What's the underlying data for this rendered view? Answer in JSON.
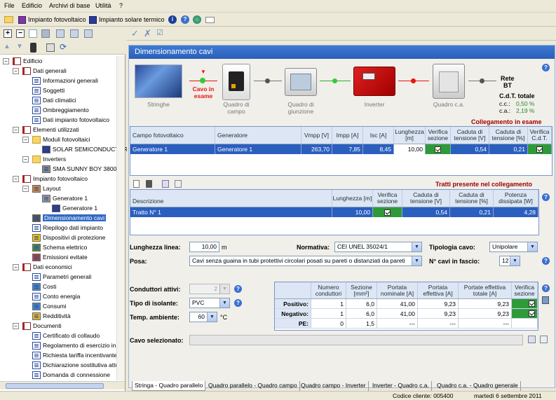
{
  "menu": [
    "File",
    "Edificio",
    "Archivi di base",
    "Utilità",
    "?"
  ],
  "toolbar": {
    "items": [
      "Impianto fotovoltaico",
      "Impianto solare termico"
    ]
  },
  "tree": [
    {
      "label": "Edificio",
      "level": 0,
      "icon": "book-icon"
    },
    {
      "label": "Dati generali",
      "level": 1,
      "icon": "book-icon"
    },
    {
      "label": "Informazioni generali",
      "level": 2,
      "icon": "document-icon"
    },
    {
      "label": "Soggetti",
      "level": 2,
      "icon": "document-icon"
    },
    {
      "label": "Dati climatici",
      "level": 2,
      "icon": "document-icon"
    },
    {
      "label": "Ombreggiamento",
      "level": 2,
      "icon": "document-icon"
    },
    {
      "label": "Dati impianto fotovoltaico",
      "level": 2,
      "icon": "document-icon"
    },
    {
      "label": "Elementi utilizzati",
      "level": 1,
      "icon": "book-icon"
    },
    {
      "label": "Moduli fotovoltaici",
      "level": 2,
      "icon": "folder-icon"
    },
    {
      "label": "SOLAR SEMICONDUCTOR",
      "level": 3,
      "icon": "module-icon"
    },
    {
      "label": "Inverters",
      "level": 2,
      "icon": "folder-icon"
    },
    {
      "label": "SMA SUNNY BOY 3800",
      "level": 3,
      "icon": "inverter-icon"
    },
    {
      "label": "Impianto fotovoltaico",
      "level": 1,
      "icon": "book-icon"
    },
    {
      "label": "Layout",
      "level": 2,
      "icon": "layout-icon"
    },
    {
      "label": "Generatore 1",
      "level": 3,
      "icon": "generator-icon"
    },
    {
      "label": "Generatore 1",
      "level": 4,
      "icon": "module-icon"
    },
    {
      "label": "Dimensionamento cavi",
      "level": 2,
      "icon": "cable-icon",
      "selected": true
    },
    {
      "label": "Riepilogo dati impianto",
      "level": 2,
      "icon": "document-icon"
    },
    {
      "label": "Dispositivi di protezione",
      "level": 2,
      "icon": "warning-icon"
    },
    {
      "label": "Schema elettrico",
      "level": 2,
      "icon": "schema-icon"
    },
    {
      "label": "Emissioni evitate",
      "level": 2,
      "icon": "chart-icon"
    },
    {
      "label": "Dati economici",
      "level": 1,
      "icon": "book-icon"
    },
    {
      "label": "Parametri generali",
      "level": 2,
      "icon": "document-icon"
    },
    {
      "label": "Costi",
      "level": 2,
      "icon": "table-icon"
    },
    {
      "label": "Conto energia",
      "level": 2,
      "icon": "document-icon"
    },
    {
      "label": "Consumi",
      "level": 2,
      "icon": "table-icon"
    },
    {
      "label": "Redditività",
      "level": 2,
      "icon": "coin-icon"
    },
    {
      "label": "Documenti",
      "level": 1,
      "icon": "book-icon"
    },
    {
      "label": "Certificato di collaudo",
      "level": 2,
      "icon": "document-icon"
    },
    {
      "label": "Regolamento di esercizio in pa",
      "level": 2,
      "icon": "document-icon"
    },
    {
      "label": "Richiesta tariffa incentivante (",
      "level": 2,
      "icon": "document-icon"
    },
    {
      "label": "Dichiarazione sostitutiva atto c",
      "level": 2,
      "icon": "document-icon"
    },
    {
      "label": "Domanda di connessione",
      "level": 2,
      "icon": "document-icon"
    }
  ],
  "content": {
    "title": "Dimensionamento cavi",
    "schematic": {
      "stringhe": "Stringhe",
      "cavo_in_esame": "Cavo in esame",
      "quadro_campo": "Quadro di campo",
      "quadro_giunzione": "Quadro di giunzione",
      "inverter": "Inverter",
      "quadro_ca": "Quadro c.a.",
      "rete": "Rete",
      "bt": "BT",
      "cdt_totale": "C.d.T. totale",
      "cc_label": "c.c.:",
      "cc_value": "0,50 %",
      "ca_label": "c.a.:",
      "ca_value": "2,19 %"
    },
    "collegamento_label": "Collegamento in esame",
    "table1": {
      "headers": [
        "Campo fotovoltaico",
        "Generatore",
        "Vmpp [V]",
        "Impp [A]",
        "Isc [A]",
        "Lunghezza [m]",
        "Verifica sezione",
        "Caduta di tensione [V]",
        "Caduta di tensione [%]",
        "Verifica C.d.T."
      ],
      "rows": [
        [
          "Generatore 1",
          "Generatore 1",
          "263,70",
          "7,85",
          "8,45",
          "10,00",
          "",
          "0,54",
          "0,21",
          ""
        ]
      ]
    },
    "tratti_label": "Tratti presente nel collegamento",
    "table2": {
      "headers": [
        "Descrizione",
        "Lunghezza [m]",
        "Verifica sezione",
        "Caduta di tensione [V]",
        "Caduta di tensione [%]",
        "Potenza dissipata [W]"
      ],
      "rows": [
        [
          "Tratto N° 1",
          "10,00",
          "",
          "0,54",
          "0,21",
          "4,28"
        ]
      ]
    },
    "form": {
      "lunghezza_label": "Lunghezza linea:",
      "lunghezza_value": "10,00",
      "lunghezza_unit": "m",
      "normativa_label": "Normativa:",
      "normativa_value": "CEI UNEL 35024/1",
      "tipologia_label": "Tipologia cavo:",
      "tipologia_value": "Unipolare",
      "posa_label": "Posa:",
      "posa_value": "Cavi senza guaina in tubi protettivi circolari posati su pareti o distanziati da pareti",
      "ncavi_label": "N° cavi in fascio:",
      "ncavi_value": "12",
      "conduttori_label": "Conduttori attivi:",
      "conduttori_value": "2",
      "isolante_label": "Tipo di isolante:",
      "isolante_value": "PVC",
      "temp_label": "Temp. ambiente:",
      "temp_value": "60",
      "temp_unit": "°C",
      "cavo_sel_label": "Cavo selezionato:"
    },
    "table3": {
      "headers": [
        "",
        "Numero conduttori",
        "Sezione [mm²]",
        "Portata nominale [A]",
        "Portata effettiva [A]",
        "Portate effettiva totale [A]",
        "Verifica sezione"
      ],
      "rows": [
        [
          "Positivo:",
          "1",
          "6,0",
          "41,00",
          "9,23",
          "9,23",
          ""
        ],
        [
          "Negativo:",
          "1",
          "6,0",
          "41,00",
          "9,23",
          "9,23",
          ""
        ],
        [
          "PE:",
          "0",
          "1,5",
          "---",
          "---",
          "---",
          ""
        ]
      ]
    },
    "tabs": [
      "Stringa - Quadro parallelo",
      "Quadro parallelo - Quadro campo",
      "Quadro campo - Inverter",
      "Inverter - Quadro c.a.",
      "Quadro c.a. - Quadro generale"
    ]
  },
  "status": {
    "codice": "Codice cliente: 005400",
    "data": "martedì 6 settembre 2011"
  },
  "colors": {
    "header_blue": "#2a5fb8",
    "selected_row": "#2b5fbf",
    "check_green": "#2f9a3a",
    "accent_red": "#a00000"
  }
}
